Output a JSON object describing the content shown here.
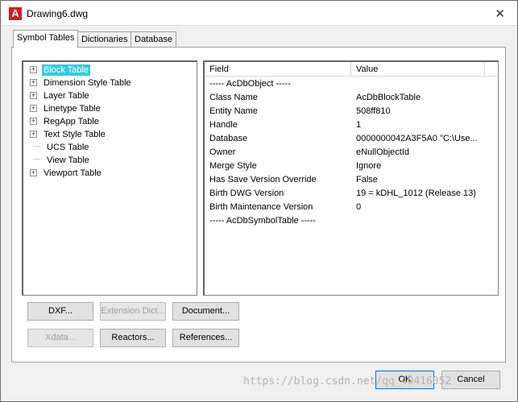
{
  "window": {
    "title": "Drawing6.dwg",
    "close_glyph": "✕"
  },
  "tabs": [
    {
      "label": "Symbol Tables",
      "active": true
    },
    {
      "label": "Dictionaries",
      "active": false
    },
    {
      "label": "Database",
      "active": false
    }
  ],
  "tree": {
    "items": [
      {
        "label": "Block Table",
        "expandable": true,
        "selected": true
      },
      {
        "label": "Dimension Style Table",
        "expandable": true
      },
      {
        "label": "Layer Table",
        "expandable": true
      },
      {
        "label": "Linetype Table",
        "expandable": true
      },
      {
        "label": "RegApp Table",
        "expandable": true
      },
      {
        "label": "Text Style Table",
        "expandable": true
      },
      {
        "label": "UCS Table",
        "expandable": false
      },
      {
        "label": "View Table",
        "expandable": false
      },
      {
        "label": "Viewport Table",
        "expandable": true
      }
    ]
  },
  "properties": {
    "columns": {
      "field": "Field",
      "value": "Value"
    },
    "rows": [
      {
        "field": "----- AcDbObject -----",
        "value": ""
      },
      {
        "field": "Class Name",
        "value": "AcDbBlockTable"
      },
      {
        "field": "Entity Name",
        "value": "508ff810"
      },
      {
        "field": "Handle",
        "value": "1"
      },
      {
        "field": "Database",
        "value": "0000000042A3F5A0  \"C:\\Use..."
      },
      {
        "field": "Owner",
        "value": "eNullObjectId"
      },
      {
        "field": "Merge Style",
        "value": "Ignore"
      },
      {
        "field": "Has Save Version Override",
        "value": "False"
      },
      {
        "field": "Birth DWG Version",
        "value": "19 = kDHL_1012  (Release 13)"
      },
      {
        "field": "Birth Maintenance Version",
        "value": "0"
      },
      {
        "field": "----- AcDbSymbolTable -----",
        "value": ""
      }
    ]
  },
  "buttons": {
    "dxf": "DXF...",
    "extension_dict": "Extension Dict...",
    "document": "Document...",
    "xdata": "Xdata...",
    "reactors": "Reactors...",
    "references": "References...",
    "ok": "OK",
    "cancel": "Cancel"
  },
  "watermark": "https://blog.csdn.net/qq_40416052",
  "colors": {
    "selection": "#33ccdd",
    "app_icon": "#d51c24"
  }
}
